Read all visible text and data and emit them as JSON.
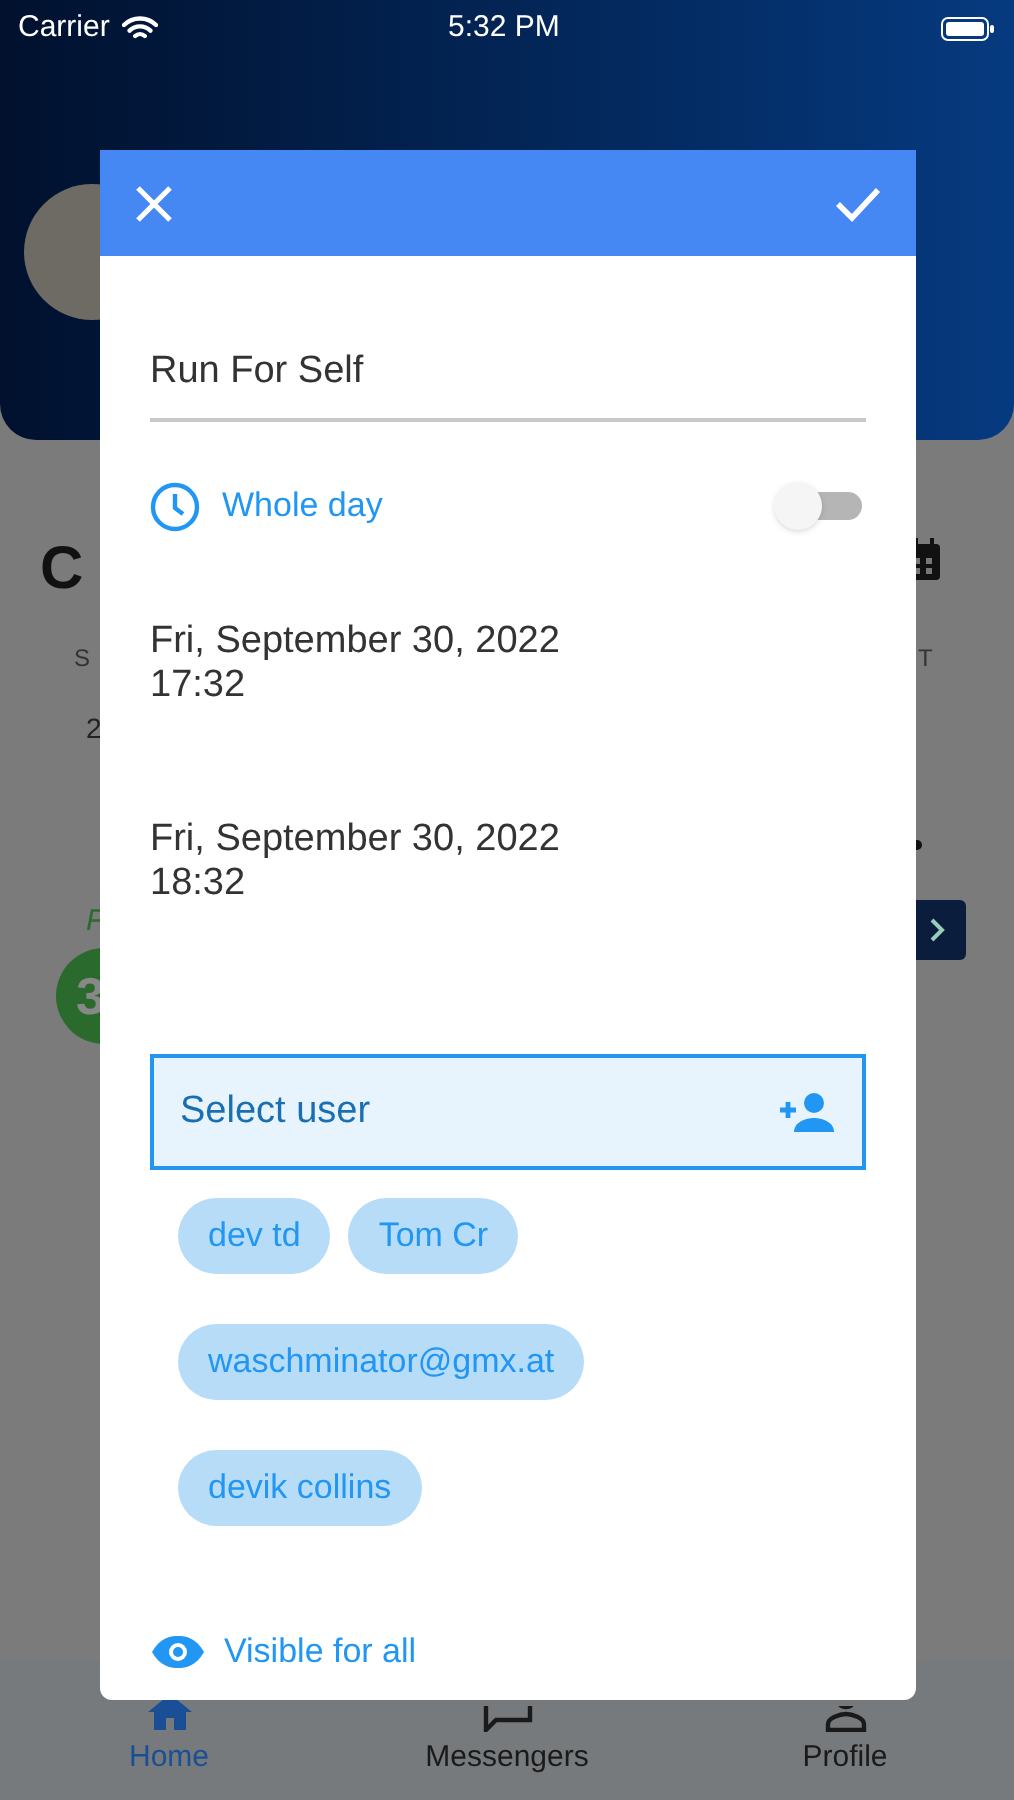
{
  "status_bar": {
    "carrier": "Carrier",
    "time": "5:32 PM"
  },
  "background": {
    "heading": "C",
    "weekday_left": "S",
    "weekday_right": "T",
    "day": "2",
    "label": "F",
    "badge": "3"
  },
  "dialog": {
    "title_value": "Run For Self",
    "whole_day": {
      "label": "Whole day",
      "on": false
    },
    "start": {
      "date": "Fri, September 30, 2022",
      "time": "17:32"
    },
    "end": {
      "date": "Fri, September 30, 2022",
      "time": "18:32"
    },
    "select_user": {
      "placeholder": "Select user"
    },
    "users": [
      [
        "dev td",
        "Tom Cr"
      ],
      [
        "waschminator@gmx.at"
      ],
      [
        "devik collins"
      ]
    ],
    "visibility": "Visible for all"
  },
  "bottom_nav": [
    {
      "label": "Home",
      "selected": true,
      "kind": "home"
    },
    {
      "label": "Messengers",
      "selected": false,
      "kind": "chat"
    },
    {
      "label": "Profile",
      "selected": false,
      "kind": "person"
    }
  ]
}
